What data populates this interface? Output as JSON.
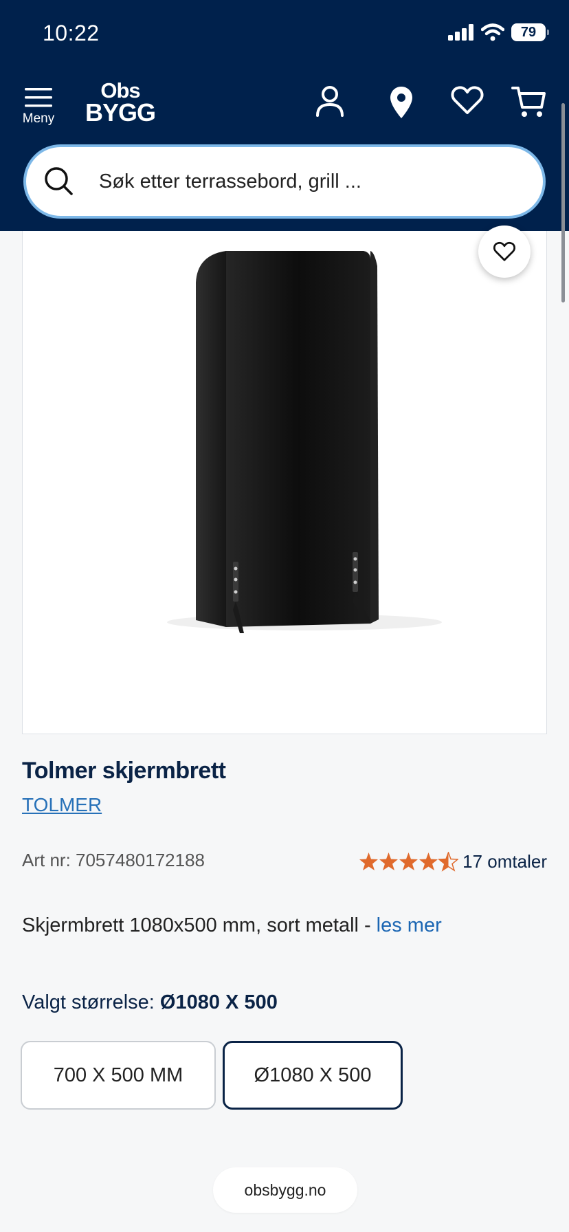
{
  "status": {
    "time": "10:22",
    "battery": "79"
  },
  "header": {
    "menu_label": "Meny",
    "logo_top": "Obs",
    "logo_bottom": "BYGG",
    "icons": [
      "user-icon",
      "location-icon",
      "heart-icon",
      "cart-icon"
    ]
  },
  "search": {
    "placeholder": "Søk etter terrassebord, grill ..."
  },
  "product": {
    "title": "Tolmer skjermbrett",
    "brand": "TOLMER",
    "art_nr": "Art nr: 7057480172188",
    "rating": 4.5,
    "reviews": "17 omtaler",
    "description": "Skjermbrett 1080x500 mm, sort metall -",
    "read_more": "les mer"
  },
  "size": {
    "label": "Valgt størrelse:",
    "selected": "Ø1080 X 500",
    "options": [
      "700 X 500 MM",
      "Ø1080 X 500"
    ]
  },
  "browser": {
    "url": "obsbygg.no"
  },
  "colors": {
    "header": "#00214c",
    "accent": "#2771b8",
    "star": "#e06a2c"
  }
}
